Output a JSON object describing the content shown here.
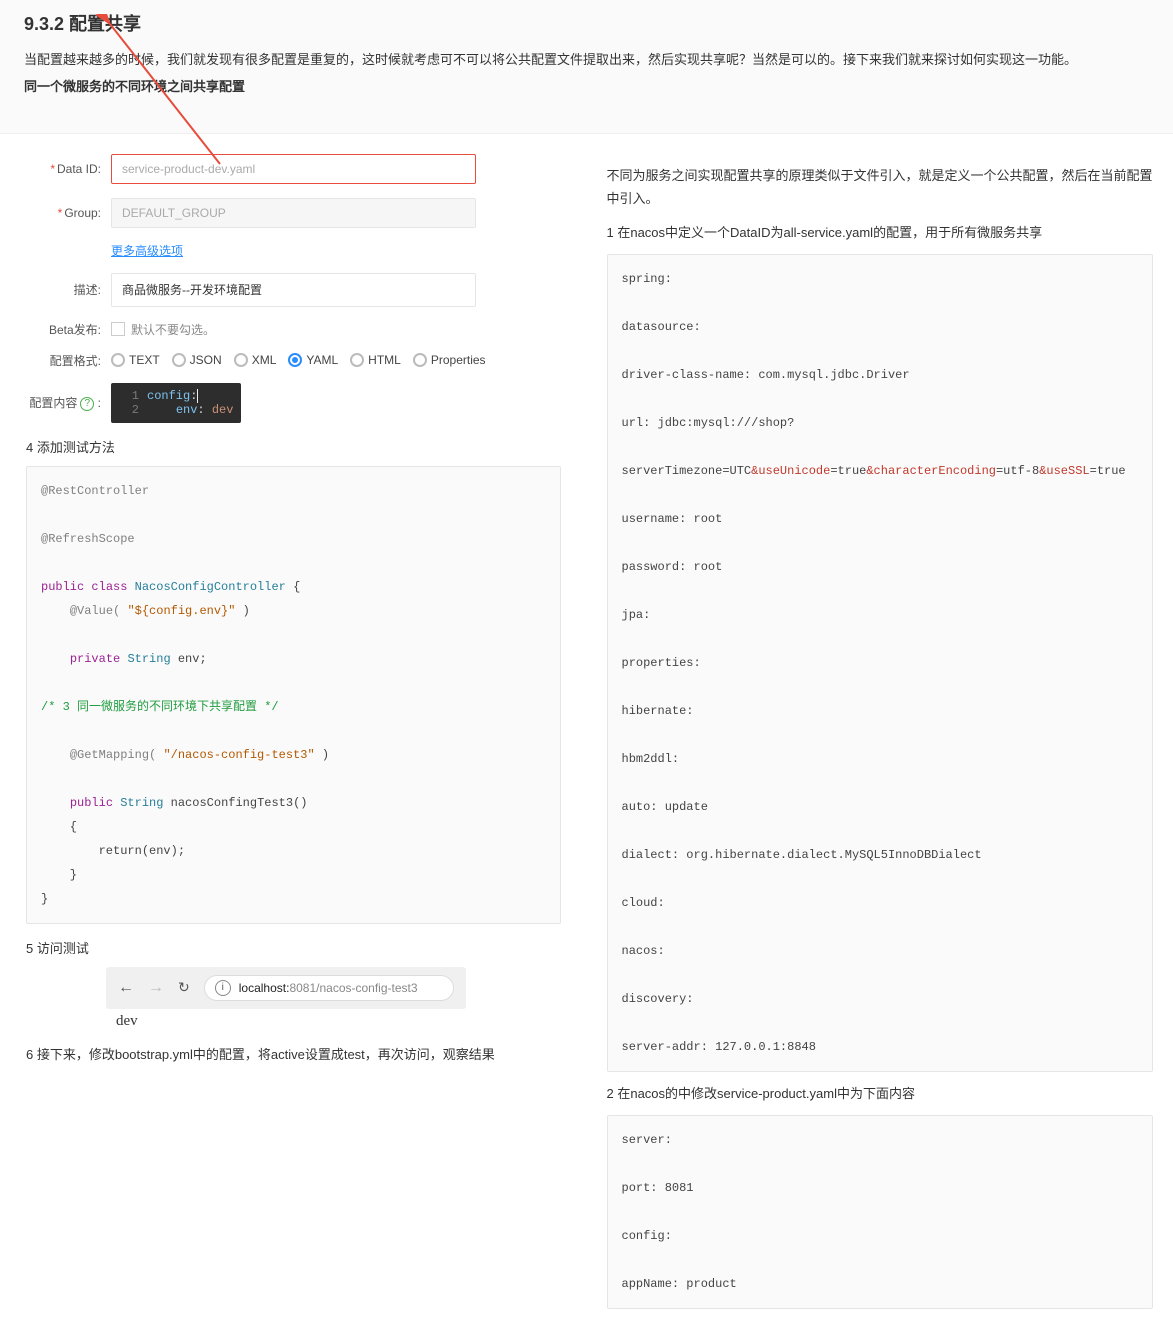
{
  "header": {
    "title": "9.3.2 配置共享",
    "p1": "当配置越来越多的时候，我们就发现有很多配置是重复的，这时候就考虑可不可以将公共配置文件提取出来，然后实现共享呢？当然是可以的。接下来我们就来探讨如何实现这一功能。",
    "p2": "同一个微服务的不同环境之间共享配置"
  },
  "form": {
    "dataid_label": "Data ID:",
    "dataid_value": "service-product-dev.yaml",
    "group_label": "Group:",
    "group_value": "DEFAULT_GROUP",
    "adv_link": "更多高级选项",
    "desc_label": "描述:",
    "desc_value": "商品微服务--开发环境配置",
    "beta_label": "Beta发布:",
    "beta_text": "默认不要勾选。",
    "format_label": "配置格式:",
    "formats": [
      "TEXT",
      "JSON",
      "XML",
      "YAML",
      "HTML",
      "Properties"
    ],
    "format_selected": "YAML",
    "content_label": "配置内容",
    "editor_l1_key": "config",
    "editor_l2_key": "env",
    "editor_l2_val": "dev"
  },
  "left": {
    "step4": "4 添加测试方法",
    "code4": {
      "anno1": "@RestController",
      "anno2": "@RefreshScope",
      "kw_public": "public",
      "kw_class": "class",
      "cls": "NacosConfigController",
      "anno_value": "@Value(",
      "value_str": "\"${config.env}\"",
      "kw_private": "private",
      "type_string": "String",
      "field": " env;",
      "comment": "/* 3 同一微服务的不同环境下共享配置 */",
      "anno_get": "@GetMapping(",
      "get_str": "\"/nacos-config-test3\"",
      "method": "nacosConfingTest3()",
      "return_line": "return(env);"
    },
    "step5": "5 访问测试",
    "browser": {
      "host": "localhost:",
      "path": "8081/nacos-config-test3",
      "output": "dev"
    },
    "step6": "6 接下来，修改bootstrap.yml中的配置，将active设置成test，再次访问，观察结果"
  },
  "right": {
    "intro": "不同为服务之间实现配置共享的原理类似于文件引入，就是定义一个公共配置，然后在当前配置中引入。",
    "step1": "1 在nacos中定义一个DataID为all-service.yaml的配置，用于所有微服务共享",
    "yaml1": {
      "l1": "spring:",
      "l2": "datasource:",
      "l3": "driver-class-name: com.mysql.jdbc.Driver",
      "l4": "url: jdbc:mysql:///shop?",
      "l5a": "serverTimezone=UTC",
      "l5r1": "&useUnicode",
      "l5b": "=true",
      "l5r2": "&characterEncoding",
      "l5c": "=utf-8",
      "l5r3": "&useSSL",
      "l5d": "=true",
      "l6": "username: root",
      "l7": "password: root",
      "l8": "jpa:",
      "l9": "properties:",
      "l10": "hibernate:",
      "l11": "hbm2ddl:",
      "l12": "auto: update",
      "l13": "dialect: org.hibernate.dialect.MySQL5InnoDBDialect",
      "l14": "cloud:",
      "l15": "nacos:",
      "l16": "discovery:",
      "l17": "server-addr: 127.0.0.1:8848"
    },
    "step2": "2 在nacos的中修改service-product.yaml中为下面内容",
    "yaml2": {
      "l1": "server:",
      "l2": "port: 8081",
      "l3": "config:",
      "l4": "appName: product"
    }
  }
}
